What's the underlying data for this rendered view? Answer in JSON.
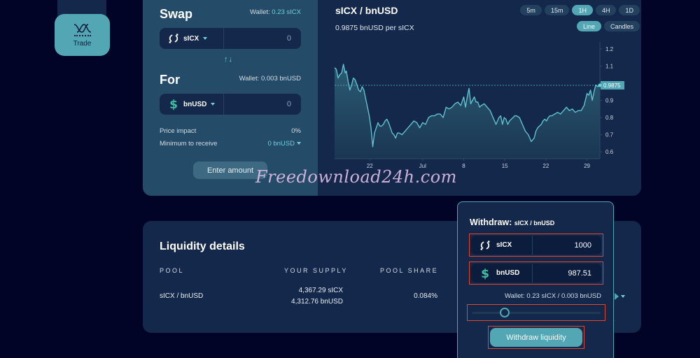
{
  "sidebar": {
    "items": [
      {
        "label": "Trade",
        "icon": "trade-wave-icon",
        "active": true
      }
    ]
  },
  "swap": {
    "title": "Swap",
    "from": {
      "wallet_label": "Wallet:",
      "wallet_value": "0.23 sICX",
      "token": "sICX",
      "token_icon": "icx-icon",
      "amount": "0"
    },
    "switch_icon": "swap-arrows-icon",
    "switch_glyph": "↑↓",
    "for_title": "For",
    "to": {
      "wallet_text": "Wallet: 0.003 bnUSD",
      "token": "bnUSD",
      "token_icon": "dollar-icon",
      "amount": "0"
    },
    "price_impact_label": "Price impact",
    "price_impact_value": "0%",
    "min_receive_label": "Minimum to receive",
    "min_receive_value": "0 bnUSD",
    "submit_label": "Enter amount"
  },
  "chart": {
    "pair": "sICX / bnUSD",
    "price_text": "0.9875 bnUSD per sICX",
    "timeframes": [
      {
        "label": "5m",
        "active": false
      },
      {
        "label": "15m",
        "active": false
      },
      {
        "label": "1H",
        "active": true
      },
      {
        "label": "4H",
        "active": false
      },
      {
        "label": "1D",
        "active": false
      }
    ],
    "modes": [
      {
        "label": "Line",
        "active": true
      },
      {
        "label": "Candles",
        "active": false
      }
    ]
  },
  "chart_data": {
    "type": "area",
    "title": "sICX / bnUSD",
    "xlabel": "",
    "ylabel": "",
    "x_ticks": [
      {
        "label": "22",
        "day": 22
      },
      {
        "label": "Jul",
        "day": 31
      },
      {
        "label": "8",
        "day": 38
      },
      {
        "label": "15",
        "day": 45
      },
      {
        "label": "22",
        "day": 52
      },
      {
        "label": "29",
        "day": 59
      }
    ],
    "x_range_days": [
      16,
      61.2
    ],
    "y_ticks": [
      0.6,
      0.7,
      0.8,
      0.9,
      1.1,
      1.2
    ],
    "ylim": [
      0.56,
      1.24
    ],
    "current_price": 0.9875,
    "current_price_label": "0.9875",
    "grid": false,
    "series": [
      {
        "name": "sICX/bnUSD price",
        "x_days": [
          16.0,
          16.3,
          16.6,
          16.9,
          17.2,
          17.5,
          17.8,
          18.0,
          18.3,
          18.6,
          18.9,
          19.2,
          19.5,
          19.8,
          20.1,
          20.4,
          20.7,
          21.0,
          21.3,
          21.6,
          21.9,
          22.2,
          22.5,
          22.8,
          23.1,
          23.4,
          23.7,
          24.0,
          24.3,
          24.6,
          24.9,
          25.2,
          25.5,
          25.8,
          26.1,
          26.4,
          26.7,
          27.0,
          27.5,
          28.0,
          28.5,
          29.0,
          29.5,
          30.0,
          30.5,
          31.0,
          31.5,
          32.0,
          32.5,
          33.0,
          33.5,
          34.0,
          34.5,
          35.0,
          35.5,
          36.0,
          36.5,
          37.0,
          37.5,
          38.0,
          38.3,
          38.6,
          38.9,
          39.2,
          39.5,
          39.8,
          40.1,
          40.4,
          40.7,
          41.0,
          41.5,
          42.0,
          42.5,
          43.0,
          43.5,
          44.0,
          44.3,
          44.6,
          44.9,
          45.2,
          45.5,
          45.8,
          46.1,
          46.4,
          46.7,
          47.0,
          47.5,
          48.0,
          48.5,
          49.0,
          49.5,
          50.0,
          50.3,
          50.6,
          50.9,
          51.2,
          51.5,
          51.8,
          52.1,
          52.4,
          52.7,
          53.0,
          53.5,
          54.0,
          54.5,
          55.0,
          55.5,
          56.0,
          56.5,
          57.0,
          57.5,
          58.0,
          58.5,
          59.0,
          59.3,
          59.6,
          59.9,
          60.2,
          60.5,
          60.8,
          61.2
        ],
        "values": [
          1.09,
          1.08,
          1.03,
          1.05,
          1.06,
          1.11,
          1.06,
          1.07,
          1.01,
          0.96,
          0.99,
          1.03,
          1.02,
          0.99,
          0.96,
          0.95,
          0.98,
          0.96,
          0.91,
          0.86,
          0.81,
          0.74,
          0.63,
          0.71,
          0.74,
          0.77,
          0.75,
          0.75,
          0.76,
          0.78,
          0.79,
          0.77,
          0.74,
          0.71,
          0.7,
          0.68,
          0.71,
          0.71,
          0.7,
          0.72,
          0.74,
          0.76,
          0.78,
          0.77,
          0.74,
          0.77,
          0.76,
          0.8,
          0.81,
          0.81,
          0.82,
          0.82,
          0.8,
          0.86,
          0.85,
          0.86,
          0.88,
          0.89,
          0.87,
          0.92,
          0.86,
          0.92,
          0.97,
          0.88,
          0.9,
          0.92,
          0.89,
          0.89,
          0.86,
          0.87,
          0.88,
          0.86,
          0.84,
          0.8,
          0.76,
          0.8,
          0.81,
          0.76,
          0.8,
          0.79,
          0.76,
          0.78,
          0.79,
          0.8,
          0.81,
          0.81,
          0.8,
          0.76,
          0.72,
          0.7,
          0.66,
          0.68,
          0.72,
          0.74,
          0.75,
          0.76,
          0.78,
          0.79,
          0.78,
          0.8,
          0.81,
          0.81,
          0.82,
          0.83,
          0.82,
          0.84,
          0.86,
          0.84,
          0.85,
          0.83,
          0.84,
          0.84,
          0.87,
          0.94,
          0.93,
          0.96,
          0.9,
          0.95,
          0.99,
          0.98,
          0.9875
        ]
      }
    ]
  },
  "watermark": "Freedownload24h.com",
  "liquidity": {
    "title": "Liquidity details",
    "columns": [
      "POOL",
      "YOUR SUPPLY",
      "POOL SHARE"
    ],
    "rows": [
      {
        "pool": "sICX / bnUSD",
        "supply_a": "4,367.29 sICX",
        "supply_b": "4,312.76 bnUSD",
        "share": "0.084%"
      }
    ]
  },
  "withdraw": {
    "title": "Withdraw:",
    "pair": "sICX / bnUSD",
    "inputs": [
      {
        "token": "sICX",
        "icon": "icx-icon",
        "value": "1000"
      },
      {
        "token": "bnUSD",
        "icon": "dollar-icon",
        "value": "987.51"
      }
    ],
    "wallet_text": "Wallet: 0.23 sICX / 0.003 bnUSD",
    "slider_fraction": 0.23,
    "button_label": "Withdraw liquidity"
  },
  "colors": {
    "accent": "#53a7b5",
    "accent_text": "#6ed0de",
    "highlight_box": "#e2452c",
    "dollar_green": "#3fbf9f"
  }
}
